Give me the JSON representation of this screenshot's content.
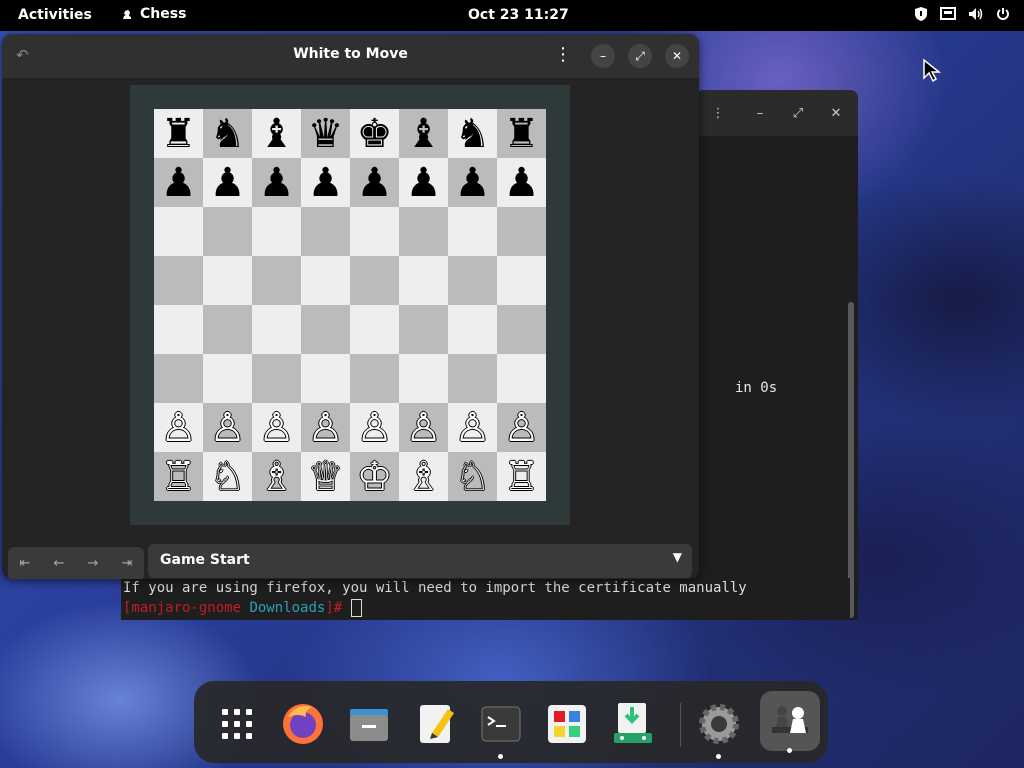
{
  "topbar": {
    "activities": "Activities",
    "app_name": "Chess",
    "clock": "Oct 23  11:27"
  },
  "chess_window": {
    "title": "White to Move",
    "history_label": "Game Start",
    "board": [
      [
        "♜",
        "♞",
        "♝",
        "♛",
        "♚",
        "♝",
        "♞",
        "♜"
      ],
      [
        "♟",
        "♟",
        "♟",
        "♟",
        "♟",
        "♟",
        "♟",
        "♟"
      ],
      [
        "",
        "",
        "",
        "",
        "",
        "",
        "",
        ""
      ],
      [
        "",
        "",
        "",
        "",
        "",
        "",
        "",
        ""
      ],
      [
        "",
        "",
        "",
        "",
        "",
        "",
        "",
        ""
      ],
      [
        "",
        "",
        "",
        "",
        "",
        "",
        "",
        ""
      ],
      [
        "♙",
        "♙",
        "♙",
        "♙",
        "♙",
        "♙",
        "♙",
        "♙"
      ],
      [
        "♖",
        "♘",
        "♗",
        "♕",
        "♔",
        "♗",
        "♘",
        "♖"
      ]
    ]
  },
  "terminal": {
    "partial_text": "in 0s",
    "line1": "If you are using firefox, you will need to import the certificate manually",
    "prompt_host": "[manjaro-gnome",
    "prompt_dir": "Downloads",
    "prompt_end": "]#"
  },
  "dock": {
    "items": [
      "app-grid",
      "firefox",
      "files",
      "text-editor",
      "terminal",
      "software",
      "downloader",
      "settings",
      "chess"
    ]
  }
}
